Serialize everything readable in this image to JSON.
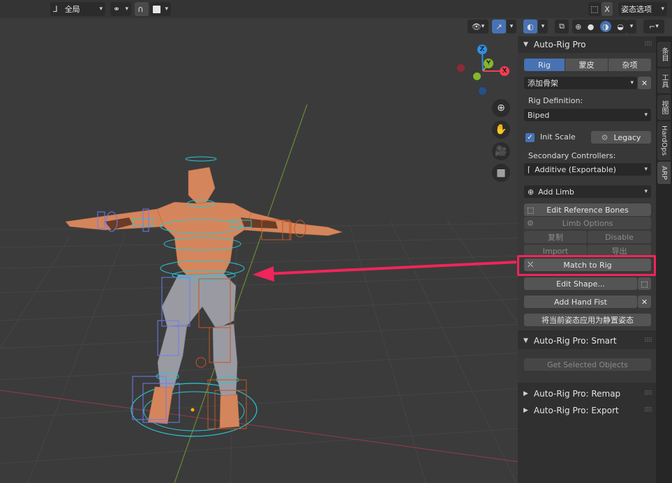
{
  "header": {
    "orientation_label": "全局",
    "pose_options_label": "姿态选项",
    "x_label": "X"
  },
  "gizmo": {
    "z": "Z",
    "y": "Y",
    "x": "X"
  },
  "sidebar": {
    "panel_title": "Auto-Rig Pro",
    "tabs": [
      "Rig",
      "蒙皮",
      "杂项"
    ],
    "add_armature": "添加骨架",
    "rig_definition_label": "Rig Definition:",
    "rig_definition_value": "Biped",
    "init_scale_label": "Init Scale",
    "legacy_label": "Legacy",
    "secondary_controllers_label": "Secondary Controllers:",
    "secondary_controllers_value": "Additive (Exportable)",
    "add_limb_label": "Add Limb",
    "edit_reference_bones": "Edit Reference Bones",
    "limb_options": "Limb Options",
    "duplicate": "复制",
    "disable": "Disable",
    "import": "Import",
    "export": "导出",
    "match_to_rig": "Match to Rig",
    "edit_shape": "Edit Shape...",
    "add_hand_fist": "Add Hand Fist",
    "apply_pose_as_rest": "将当前姿态应用为静置姿态",
    "smart_title": "Auto-Rig Pro: Smart",
    "get_selected_objects": "Get Selected Objects",
    "remap_title": "Auto-Rig Pro: Remap",
    "export_title": "Auto-Rig Pro: Export"
  },
  "vertical_tabs": [
    "条目",
    "工具",
    "视图",
    "HardOps",
    "ARP"
  ],
  "colors": {
    "accent": "#4772b3",
    "highlight": "#f0255a",
    "panel_bg": "#383838",
    "viewport_bg": "#3b3b3b"
  }
}
